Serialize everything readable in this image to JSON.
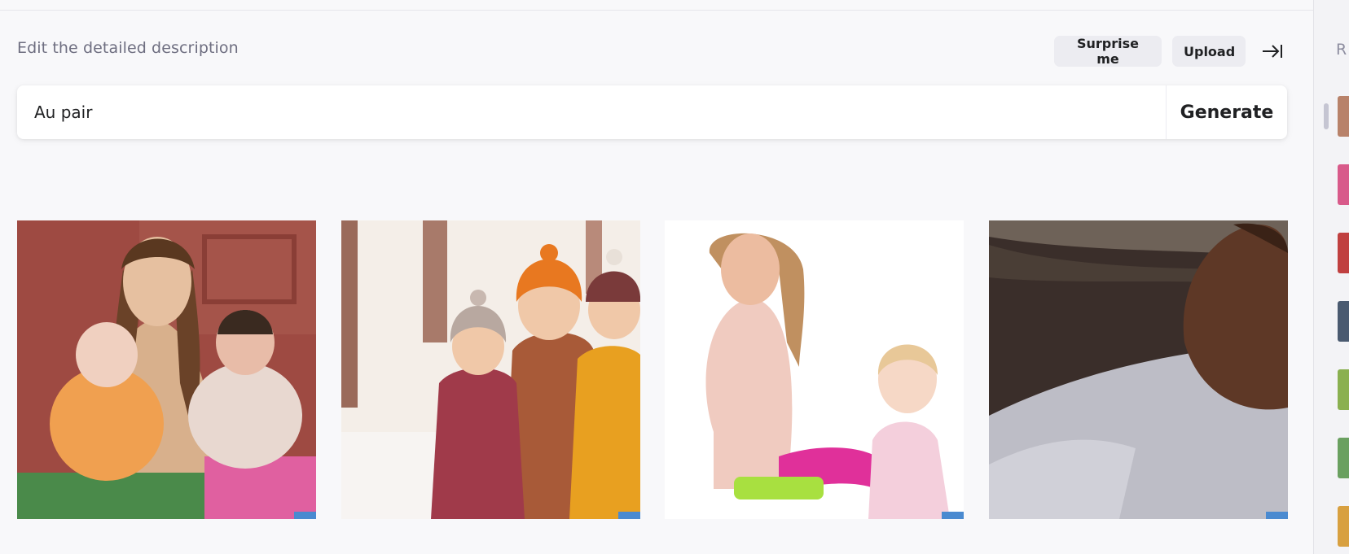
{
  "heading": "Edit the detailed description",
  "buttons": {
    "surprise": "Surprise me",
    "upload": "Upload",
    "generate": "Generate"
  },
  "prompt": {
    "value": "Au pair"
  },
  "collapse_icon": "arrow-right-to-bar-icon",
  "results": [
    {
      "subject": "woman-holding-two-babies"
    },
    {
      "subject": "woman-and-two-children-in-snow"
    },
    {
      "subject": "woman-and-toddler-on-white-floor"
    },
    {
      "subject": "man-on-couch"
    }
  ],
  "sidebar": {
    "label": "R",
    "thumbnails": [
      {
        "color": "#b8826a"
      },
      {
        "color": "#d85a8a"
      },
      {
        "color": "#c04040"
      },
      {
        "color": "#4a5a70"
      },
      {
        "color": "#8ab050"
      },
      {
        "color": "#6aa060"
      },
      {
        "color": "#d8a040"
      }
    ]
  },
  "colors": {
    "background": "#f8f8fa",
    "button": "#ececf1",
    "text": "#202123",
    "muted": "#6e6e80"
  }
}
